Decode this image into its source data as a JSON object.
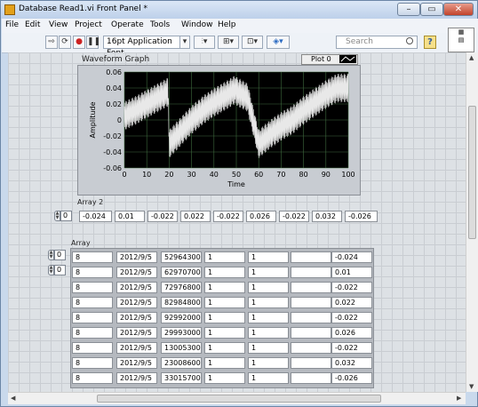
{
  "window": {
    "title": "Database Read1.vi Front Panel *",
    "close_glyph": "✕",
    "minimize_glyph": "–",
    "maximize_glyph": "▭"
  },
  "menu": [
    "File",
    "Edit",
    "View",
    "Project",
    "Operate",
    "Tools",
    "Window",
    "Help"
  ],
  "toolbar": {
    "font": "16pt Application Font",
    "search_placeholder": "Search",
    "help_glyph": "?"
  },
  "graph": {
    "label": "Waveform Graph",
    "plot_legend": "Plot 0"
  },
  "chart_data": {
    "type": "line",
    "title": "",
    "xlabel": "Time",
    "ylabel": "Amplitude",
    "xlim": [
      0,
      100
    ],
    "ylim": [
      -0.06,
      0.06
    ],
    "x_ticks": [
      0,
      10,
      20,
      30,
      40,
      50,
      60,
      70,
      80,
      90,
      100
    ],
    "y_ticks": [
      -0.06,
      -0.04,
      -0.02,
      0,
      0.02,
      0.04,
      0.06
    ],
    "y_tick_labels": [
      "-0.06",
      "-0.04",
      "-0.02",
      "0",
      "0.02",
      "0.04",
      "0.06"
    ],
    "grid": true,
    "colors": {
      "plot_background": "#000000",
      "trace": "#e8e8e8",
      "grid": "#3e6a3e"
    },
    "series": [
      {
        "note_shape": "sawtooth with dense oscillation",
        "x": [
          0,
          5,
          10,
          15,
          19.5,
          20,
          25,
          30,
          35,
          40,
          45,
          49.5,
          50,
          55,
          60,
          65,
          70,
          75,
          80,
          85,
          90,
          95,
          100
        ],
        "y": [
          0.005,
          0.012,
          0.02,
          0.028,
          0.035,
          -0.03,
          -0.015,
          0.0,
          0.012,
          0.022,
          0.03,
          0.038,
          0.036,
          0.028,
          -0.03,
          -0.018,
          -0.008,
          0.0,
          0.012,
          0.022,
          0.032,
          0.04,
          0.04
        ]
      }
    ]
  },
  "array2": {
    "label": "Array 2",
    "index": "0",
    "values": [
      "-0.024",
      "0.01",
      "-0.022",
      "0.022",
      "-0.022",
      "0.026",
      "-0.022",
      "0.032",
      "-0.026"
    ]
  },
  "array": {
    "label": "Array",
    "index_row": "0",
    "index_col": "0",
    "rows": [
      [
        "8",
        "2012/9/5",
        "52964300",
        "1",
        "1",
        "",
        "-0.024"
      ],
      [
        "8",
        "2012/9/5",
        "62970700",
        "1",
        "1",
        "",
        "0.01"
      ],
      [
        "8",
        "2012/9/5",
        "72976800",
        "1",
        "1",
        "",
        "-0.022"
      ],
      [
        "8",
        "2012/9/5",
        "82984800",
        "1",
        "1",
        "",
        "0.022"
      ],
      [
        "8",
        "2012/9/5",
        "92992000",
        "1",
        "1",
        "",
        "-0.022"
      ],
      [
        "8",
        "2012/9/5",
        "29993000",
        "1",
        "1",
        "",
        "0.026"
      ],
      [
        "8",
        "2012/9/5",
        "13005300",
        "1",
        "1",
        "",
        "-0.022"
      ],
      [
        "8",
        "2012/9/5",
        "23008600",
        "1",
        "1",
        "",
        "0.032"
      ],
      [
        "8",
        "2012/9/5",
        "33015700",
        "1",
        "1",
        "",
        "-0.026"
      ]
    ]
  }
}
